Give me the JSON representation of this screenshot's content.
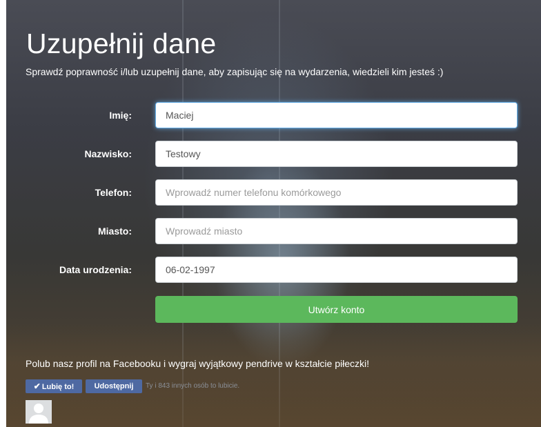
{
  "form": {
    "title": "Uzupełnij dane",
    "subtitle": "Sprawdź poprawność i/lub uzupełnij dane, aby zapisując się na wydarzenia, wiedzieli kim jesteś :)",
    "fields": [
      {
        "label": "Imię:",
        "value": "Maciej",
        "placeholder": ""
      },
      {
        "label": "Nazwisko:",
        "value": "Testowy",
        "placeholder": ""
      },
      {
        "label": "Telefon:",
        "value": "",
        "placeholder": "Wprowadź numer telefonu komórkowego"
      },
      {
        "label": "Miasto:",
        "value": "",
        "placeholder": "Wprowadź miasto"
      },
      {
        "label": "Data urodzenia:",
        "value": "06-02-1997",
        "placeholder": ""
      }
    ],
    "submit_label": "Utwórz konto"
  },
  "facebook": {
    "promo_text": "Polub nasz profil na Facebooku i wygraj wyjątkowy pendrive w kształcie piłeczki!",
    "like_label": "Lubię to!",
    "share_label": "Udostępnij",
    "count_text": "Ty i 843 innych osób to lubicie."
  },
  "colors": {
    "submit": "#5cb85c",
    "facebook": "#4e69a2",
    "focus": "#66afe9"
  }
}
